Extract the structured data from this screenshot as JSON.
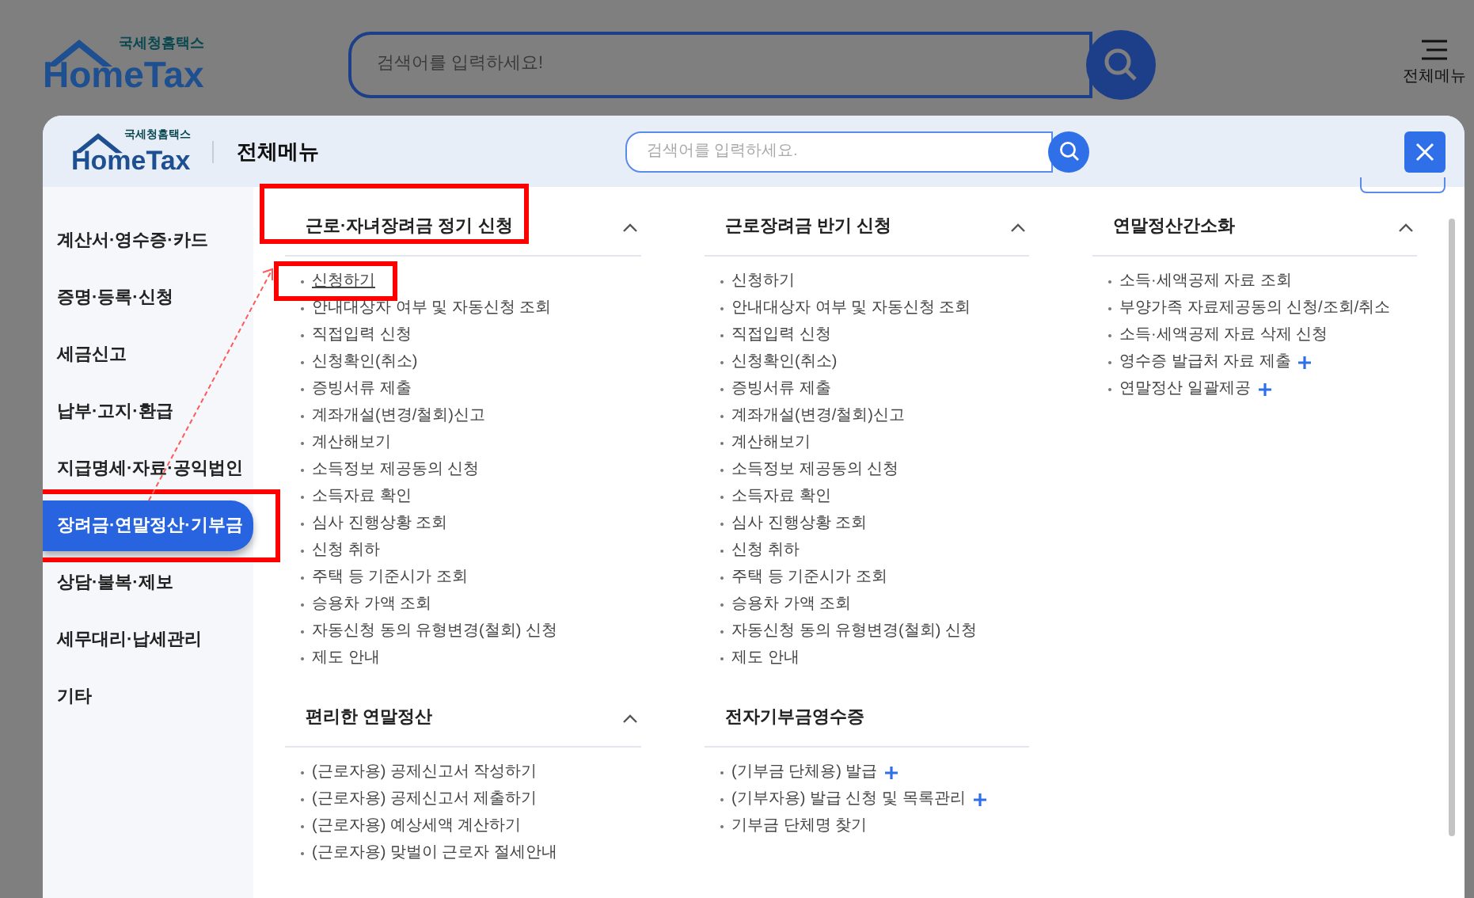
{
  "header": {
    "logo_small": "국세청홈택스",
    "logo": "HomeTax",
    "search_placeholder": "검색어를 입력하세요!",
    "menu_label": "전체메뉴"
  },
  "modal": {
    "logo_small": "국세청홈택스",
    "logo": "HomeTax",
    "title": "전체메뉴",
    "search_placeholder": "검색어를 입력하세요."
  },
  "sidebar": [
    {
      "label": "계산서·영수증·카드",
      "selected": false,
      "highlighted": false
    },
    {
      "label": "증명·등록·신청",
      "selected": false,
      "highlighted": false
    },
    {
      "label": "세금신고",
      "selected": false,
      "highlighted": false
    },
    {
      "label": "납부·고지·환급",
      "selected": false,
      "highlighted": false
    },
    {
      "label": "지급명세·자료·공익법인",
      "selected": false,
      "highlighted": false
    },
    {
      "label": "장려금·연말정산·기부금",
      "selected": true,
      "highlighted": true
    },
    {
      "label": "상담·불복·제보",
      "selected": false,
      "highlighted": false
    },
    {
      "label": "세무대리·납세관리",
      "selected": false,
      "highlighted": false
    },
    {
      "label": "기타",
      "selected": false,
      "highlighted": false
    }
  ],
  "columns": [
    [
      {
        "title": "근로·자녀장려금 정기 신청",
        "expanded": true,
        "highlighted": true,
        "links": [
          {
            "label": "신청하기",
            "highlighted": true,
            "plus": false
          },
          {
            "label": "안내대상자 여부 및 자동신청 조회",
            "highlighted": false,
            "plus": false
          },
          {
            "label": "직접입력 신청",
            "highlighted": false,
            "plus": false
          },
          {
            "label": "신청확인(취소)",
            "highlighted": false,
            "plus": false
          },
          {
            "label": "증빙서류 제출",
            "highlighted": false,
            "plus": false
          },
          {
            "label": "계좌개설(변경/철회)신고",
            "highlighted": false,
            "plus": false
          },
          {
            "label": "계산해보기",
            "highlighted": false,
            "plus": false
          },
          {
            "label": "소득정보 제공동의 신청",
            "highlighted": false,
            "plus": false
          },
          {
            "label": "소득자료 확인",
            "highlighted": false,
            "plus": false
          },
          {
            "label": "심사 진행상황 조회",
            "highlighted": false,
            "plus": false
          },
          {
            "label": "신청 취하",
            "highlighted": false,
            "plus": false
          },
          {
            "label": "주택 등 기준시가 조회",
            "highlighted": false,
            "plus": false
          },
          {
            "label": "승용차 가액 조회",
            "highlighted": false,
            "plus": false
          },
          {
            "label": "자동신청 동의 유형변경(철회) 신청",
            "highlighted": false,
            "plus": false
          },
          {
            "label": "제도 안내",
            "highlighted": false,
            "plus": false
          }
        ]
      },
      {
        "title": "편리한 연말정산",
        "expanded": true,
        "highlighted": false,
        "links": [
          {
            "label": "(근로자용) 공제신고서 작성하기",
            "highlighted": false,
            "plus": false
          },
          {
            "label": "(근로자용) 공제신고서 제출하기",
            "highlighted": false,
            "plus": false
          },
          {
            "label": "(근로자용) 예상세액 계산하기",
            "highlighted": false,
            "plus": false
          },
          {
            "label": "(근로자용) 맞벌이 근로자 절세안내",
            "highlighted": false,
            "plus": false
          }
        ]
      }
    ],
    [
      {
        "title": "근로장려금 반기 신청",
        "expanded": true,
        "highlighted": false,
        "links": [
          {
            "label": "신청하기",
            "highlighted": false,
            "plus": false
          },
          {
            "label": "안내대상자 여부 및 자동신청 조회",
            "highlighted": false,
            "plus": false
          },
          {
            "label": "직접입력 신청",
            "highlighted": false,
            "plus": false
          },
          {
            "label": "신청확인(취소)",
            "highlighted": false,
            "plus": false
          },
          {
            "label": "증빙서류 제출",
            "highlighted": false,
            "plus": false
          },
          {
            "label": "계좌개설(변경/철회)신고",
            "highlighted": false,
            "plus": false
          },
          {
            "label": "계산해보기",
            "highlighted": false,
            "plus": false
          },
          {
            "label": "소득정보 제공동의 신청",
            "highlighted": false,
            "plus": false
          },
          {
            "label": "소득자료 확인",
            "highlighted": false,
            "plus": false
          },
          {
            "label": "심사 진행상황 조회",
            "highlighted": false,
            "plus": false
          },
          {
            "label": "신청 취하",
            "highlighted": false,
            "plus": false
          },
          {
            "label": "주택 등 기준시가 조회",
            "highlighted": false,
            "plus": false
          },
          {
            "label": "승용차 가액 조회",
            "highlighted": false,
            "plus": false
          },
          {
            "label": "자동신청 동의 유형변경(철회) 신청",
            "highlighted": false,
            "plus": false
          },
          {
            "label": "제도 안내",
            "highlighted": false,
            "plus": false
          }
        ]
      },
      {
        "title": "전자기부금영수증",
        "highlighted": false,
        "links": [
          {
            "label": "(기부금 단체용) 발급",
            "highlighted": false,
            "plus": true
          },
          {
            "label": "(기부자용) 발급 신청 및 목록관리",
            "highlighted": false,
            "plus": true
          },
          {
            "label": "기부금 단체명 찾기",
            "highlighted": false,
            "plus": false
          }
        ]
      }
    ],
    [
      {
        "title": "연말정산간소화",
        "expanded": true,
        "highlighted": false,
        "links": [
          {
            "label": "소득·세액공제 자료 조회",
            "highlighted": false,
            "plus": false
          },
          {
            "label": "부양가족 자료제공동의 신청/조회/취소",
            "highlighted": false,
            "plus": false
          },
          {
            "label": "소득·세액공제 자료 삭제 신청",
            "highlighted": false,
            "plus": false
          },
          {
            "label": "영수증 발급처 자료 제출",
            "highlighted": false,
            "plus": true
          },
          {
            "label": "연말정산 일괄제공",
            "highlighted": false,
            "plus": true
          }
        ]
      }
    ]
  ]
}
